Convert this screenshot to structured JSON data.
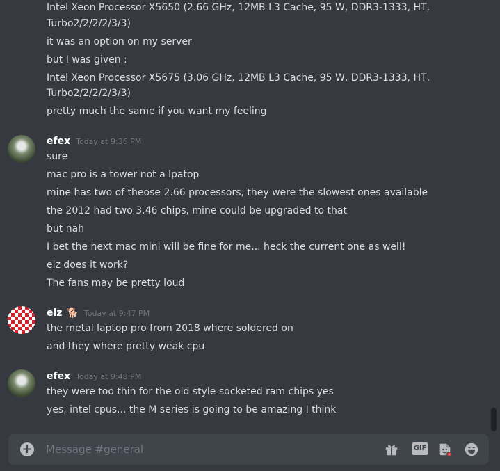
{
  "channel": {
    "input_placeholder": "Message #general"
  },
  "messages": [
    {
      "lines": [
        "Intel Xeon Processor X5650 (2.66 GHz, 12MB L3 Cache, 95 W, DDR3-1333, HT,",
        "Turbo2/2/2/2/3/3)",
        "it was an option on my server",
        "but I was given :",
        "Intel Xeon Processor X5675 (3.06 GHz, 12MB L3 Cache, 95 W, DDR3-1333, HT,",
        "Turbo2/2/2/2/3/3)",
        "pretty much the same if you want my feeling"
      ]
    },
    {
      "author": "efex",
      "timestamp": "Today at 9:36 PM",
      "lines": [
        "sure",
        "mac  pro is a tower not a lpatop",
        "mine has two of theose 2.66 processors, they were the slowest ones available",
        "the 2012 had two 3.46 chips, mine could be upgraded to that",
        "but nah",
        "I bet the next mac mini will be fine for me... heck the current one as well!",
        "elz does it work?",
        "The fans may be pretty loud"
      ]
    },
    {
      "author": "elz",
      "badge": "🐕",
      "timestamp": "Today at 9:47 PM",
      "lines": [
        "the metal laptop pro from 2018 where soldered on",
        "and they where pretty weak cpu"
      ]
    },
    {
      "author": "efex",
      "timestamp": "Today at 9:48 PM",
      "lines": [
        "they were too thin for the old style socketed ram chips yes",
        "yes, intel cpus... the M series is going to be amazing I think"
      ]
    }
  ],
  "composer": {
    "plus_icon": "plus-circle-icon",
    "gift_icon": "gift-icon",
    "gif_label": "GIF",
    "sticker_icon": "sticker-icon",
    "emoji_icon": "emoji-icon"
  },
  "colors": {
    "background": "#36393f",
    "input_background": "#40444b",
    "text": "#dcddde",
    "timestamp": "#72767d",
    "username": "#ffffff"
  }
}
